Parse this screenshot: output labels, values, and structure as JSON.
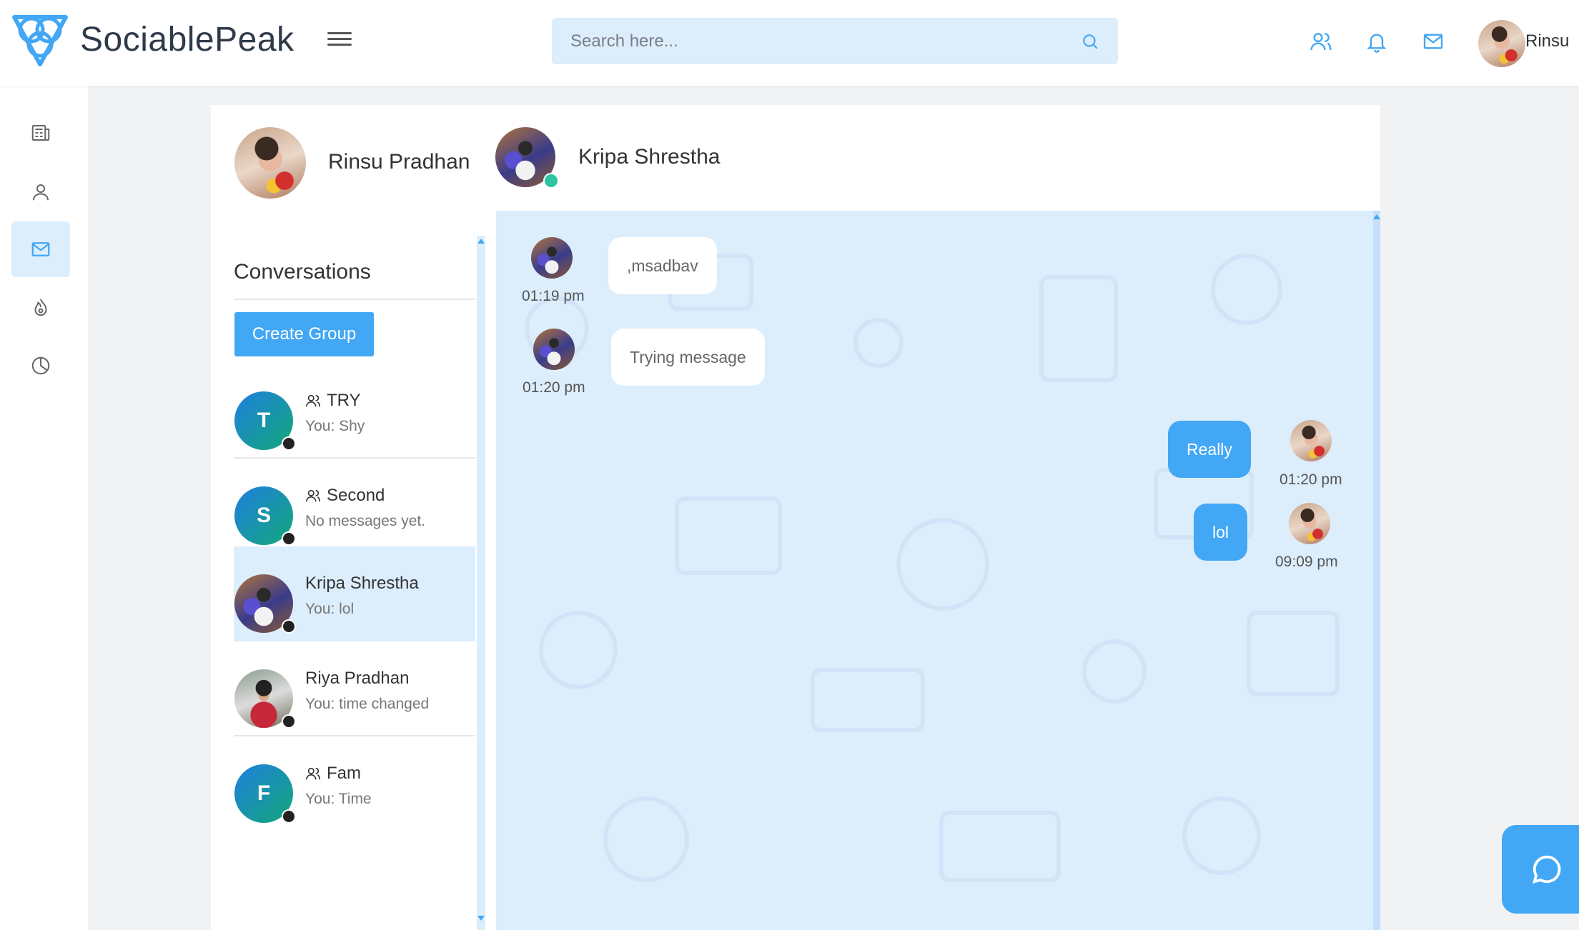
{
  "app": {
    "brand": "SociablePeak",
    "search_placeholder": "Search here...",
    "user_name": "Rinsu",
    "colors": {
      "accent": "#42a7f5",
      "light_accent": "#dcedfc",
      "online": "#2ec4a3"
    }
  },
  "topbar": {
    "icons": [
      "friends-icon",
      "bell-icon",
      "mail-icon"
    ]
  },
  "sidebar": {
    "items": [
      {
        "icon": "newsfeed-icon",
        "active": false
      },
      {
        "icon": "profile-icon",
        "active": false
      },
      {
        "icon": "messages-icon",
        "active": true
      },
      {
        "icon": "trending-icon",
        "active": false
      },
      {
        "icon": "analytics-icon",
        "active": false
      }
    ]
  },
  "profile": {
    "name": "Rinsu Pradhan"
  },
  "active_chat": {
    "name": "Kripa Shrestha",
    "online": true
  },
  "conversations": {
    "title": "Conversations",
    "create_group_label": "Create Group",
    "items": [
      {
        "name": "TRY",
        "initial": "T",
        "last": "You: Shy",
        "group": true,
        "active": false
      },
      {
        "name": "Second",
        "initial": "S",
        "last": "No messages yet.",
        "group": true,
        "active": false
      },
      {
        "name": "Kripa Shrestha",
        "initial": "",
        "last": "You: lol",
        "group": false,
        "active": true
      },
      {
        "name": "Riya Pradhan",
        "initial": "",
        "last": "You: time changed",
        "group": false,
        "active": false
      },
      {
        "name": "Fam",
        "initial": "F",
        "last": "You: Time",
        "group": true,
        "active": false
      }
    ]
  },
  "messages": [
    {
      "text": ",msadbav",
      "time": "01:19 pm",
      "from": "them"
    },
    {
      "text": "Trying message",
      "time": "01:20 pm",
      "from": "them"
    },
    {
      "text": "Really",
      "time": "01:20 pm",
      "from": "me"
    },
    {
      "text": "lol",
      "time": "09:09 pm",
      "from": "me"
    }
  ]
}
